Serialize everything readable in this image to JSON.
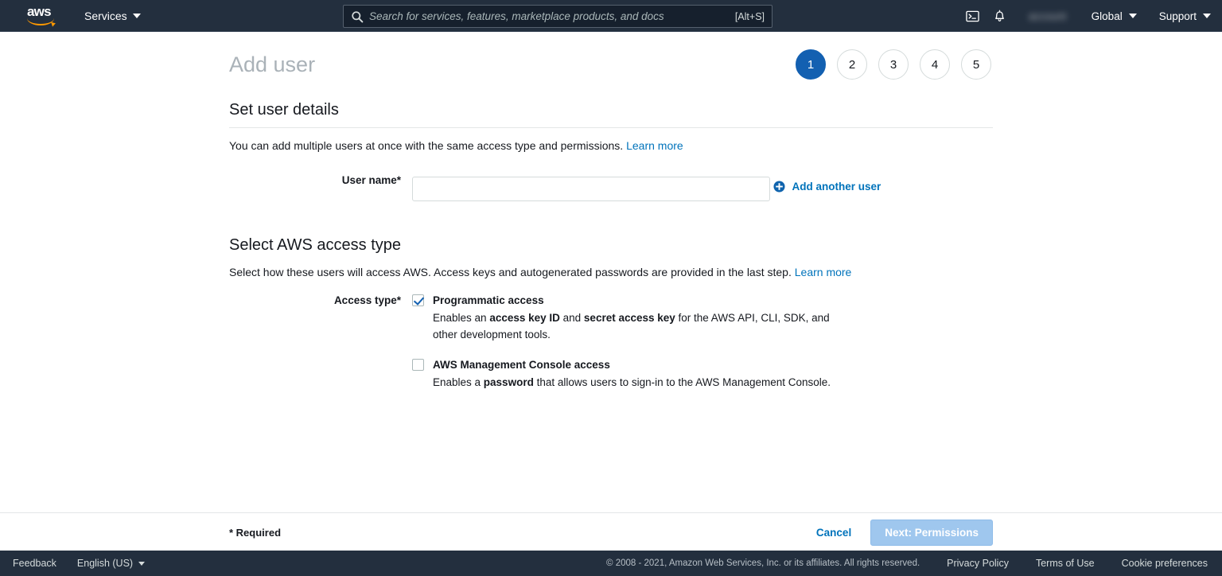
{
  "topnav": {
    "logo_alt": "aws",
    "services_label": "Services",
    "search": {
      "placeholder": "Search for services, features, marketplace products, and docs",
      "value": "",
      "hint": "[Alt+S]"
    },
    "cloudshell_icon": "terminal-icon",
    "notifications_icon": "bell-icon",
    "account_label": "",
    "region_label": "Global",
    "support_label": "Support"
  },
  "page": {
    "title": "Add user",
    "steps": [
      {
        "label": "1",
        "active": true
      },
      {
        "label": "2",
        "active": false
      },
      {
        "label": "3",
        "active": false
      },
      {
        "label": "4",
        "active": false
      },
      {
        "label": "5",
        "active": false
      }
    ]
  },
  "user_details": {
    "heading": "Set user details",
    "description": "You can add multiple users at once with the same access type and permissions.",
    "learn_more": "Learn more",
    "username_label": "User name*",
    "username_value": "",
    "username_placeholder": "",
    "add_another_user": "Add another user"
  },
  "access_type": {
    "heading": "Select AWS access type",
    "description": "Select how these users will access AWS. Access keys and autogenerated passwords are provided in the last step.",
    "learn_more": "Learn more",
    "label": "Access type*",
    "options": [
      {
        "title": "Programmatic access",
        "checked": true,
        "desc_parts": [
          {
            "text": "Enables an ",
            "bold": false
          },
          {
            "text": "access key ID",
            "bold": true
          },
          {
            "text": " and ",
            "bold": false
          },
          {
            "text": "secret access key",
            "bold": true
          },
          {
            "text": " for the AWS API, CLI, SDK, and other development tools.",
            "bold": false
          }
        ]
      },
      {
        "title": "AWS Management Console access",
        "checked": false,
        "desc_parts": [
          {
            "text": "Enables a ",
            "bold": false
          },
          {
            "text": "password",
            "bold": true
          },
          {
            "text": " that allows users to sign-in to the AWS Management Console.",
            "bold": false
          }
        ]
      }
    ]
  },
  "actionbar": {
    "required_note": "* Required",
    "cancel_label": "Cancel",
    "next_label": "Next: Permissions"
  },
  "footer": {
    "feedback": "Feedback",
    "language": "English (US)",
    "copyright": "© 2008 - 2021, Amazon Web Services, Inc. or its affiliates. All rights reserved.",
    "privacy_policy": "Privacy Policy",
    "terms_of_use": "Terms of Use",
    "cookie_preferences": "Cookie preferences"
  },
  "colors": {
    "nav_background": "#232f3e",
    "accent_blue": "#1360b1",
    "link_blue": "#0073bb",
    "logo_orange": "#ff9900",
    "disabled_button": "#9fc7ee"
  }
}
